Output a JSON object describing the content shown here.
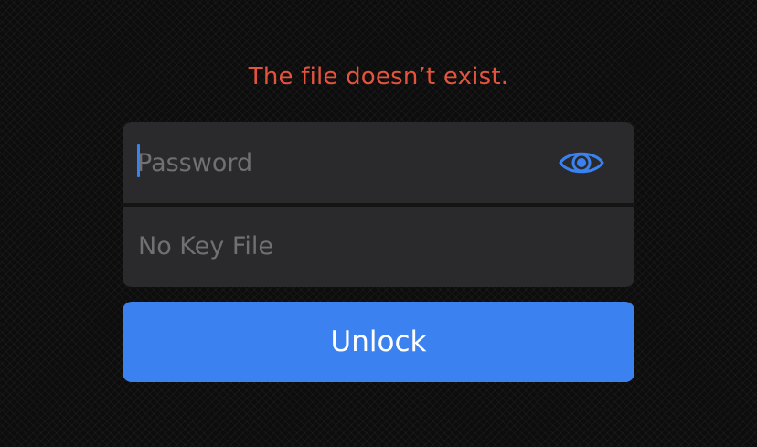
{
  "error": {
    "message": "The file doesn’t exist."
  },
  "password": {
    "placeholder": "Password",
    "value": "",
    "toggle_icon": "eye-icon"
  },
  "key_file": {
    "label": "No Key File"
  },
  "unlock": {
    "label": "Unlock"
  },
  "colors": {
    "error": "#e5533d",
    "accent": "#3b82f0",
    "card_background": "#2a2a2c",
    "placeholder": "#707074"
  }
}
